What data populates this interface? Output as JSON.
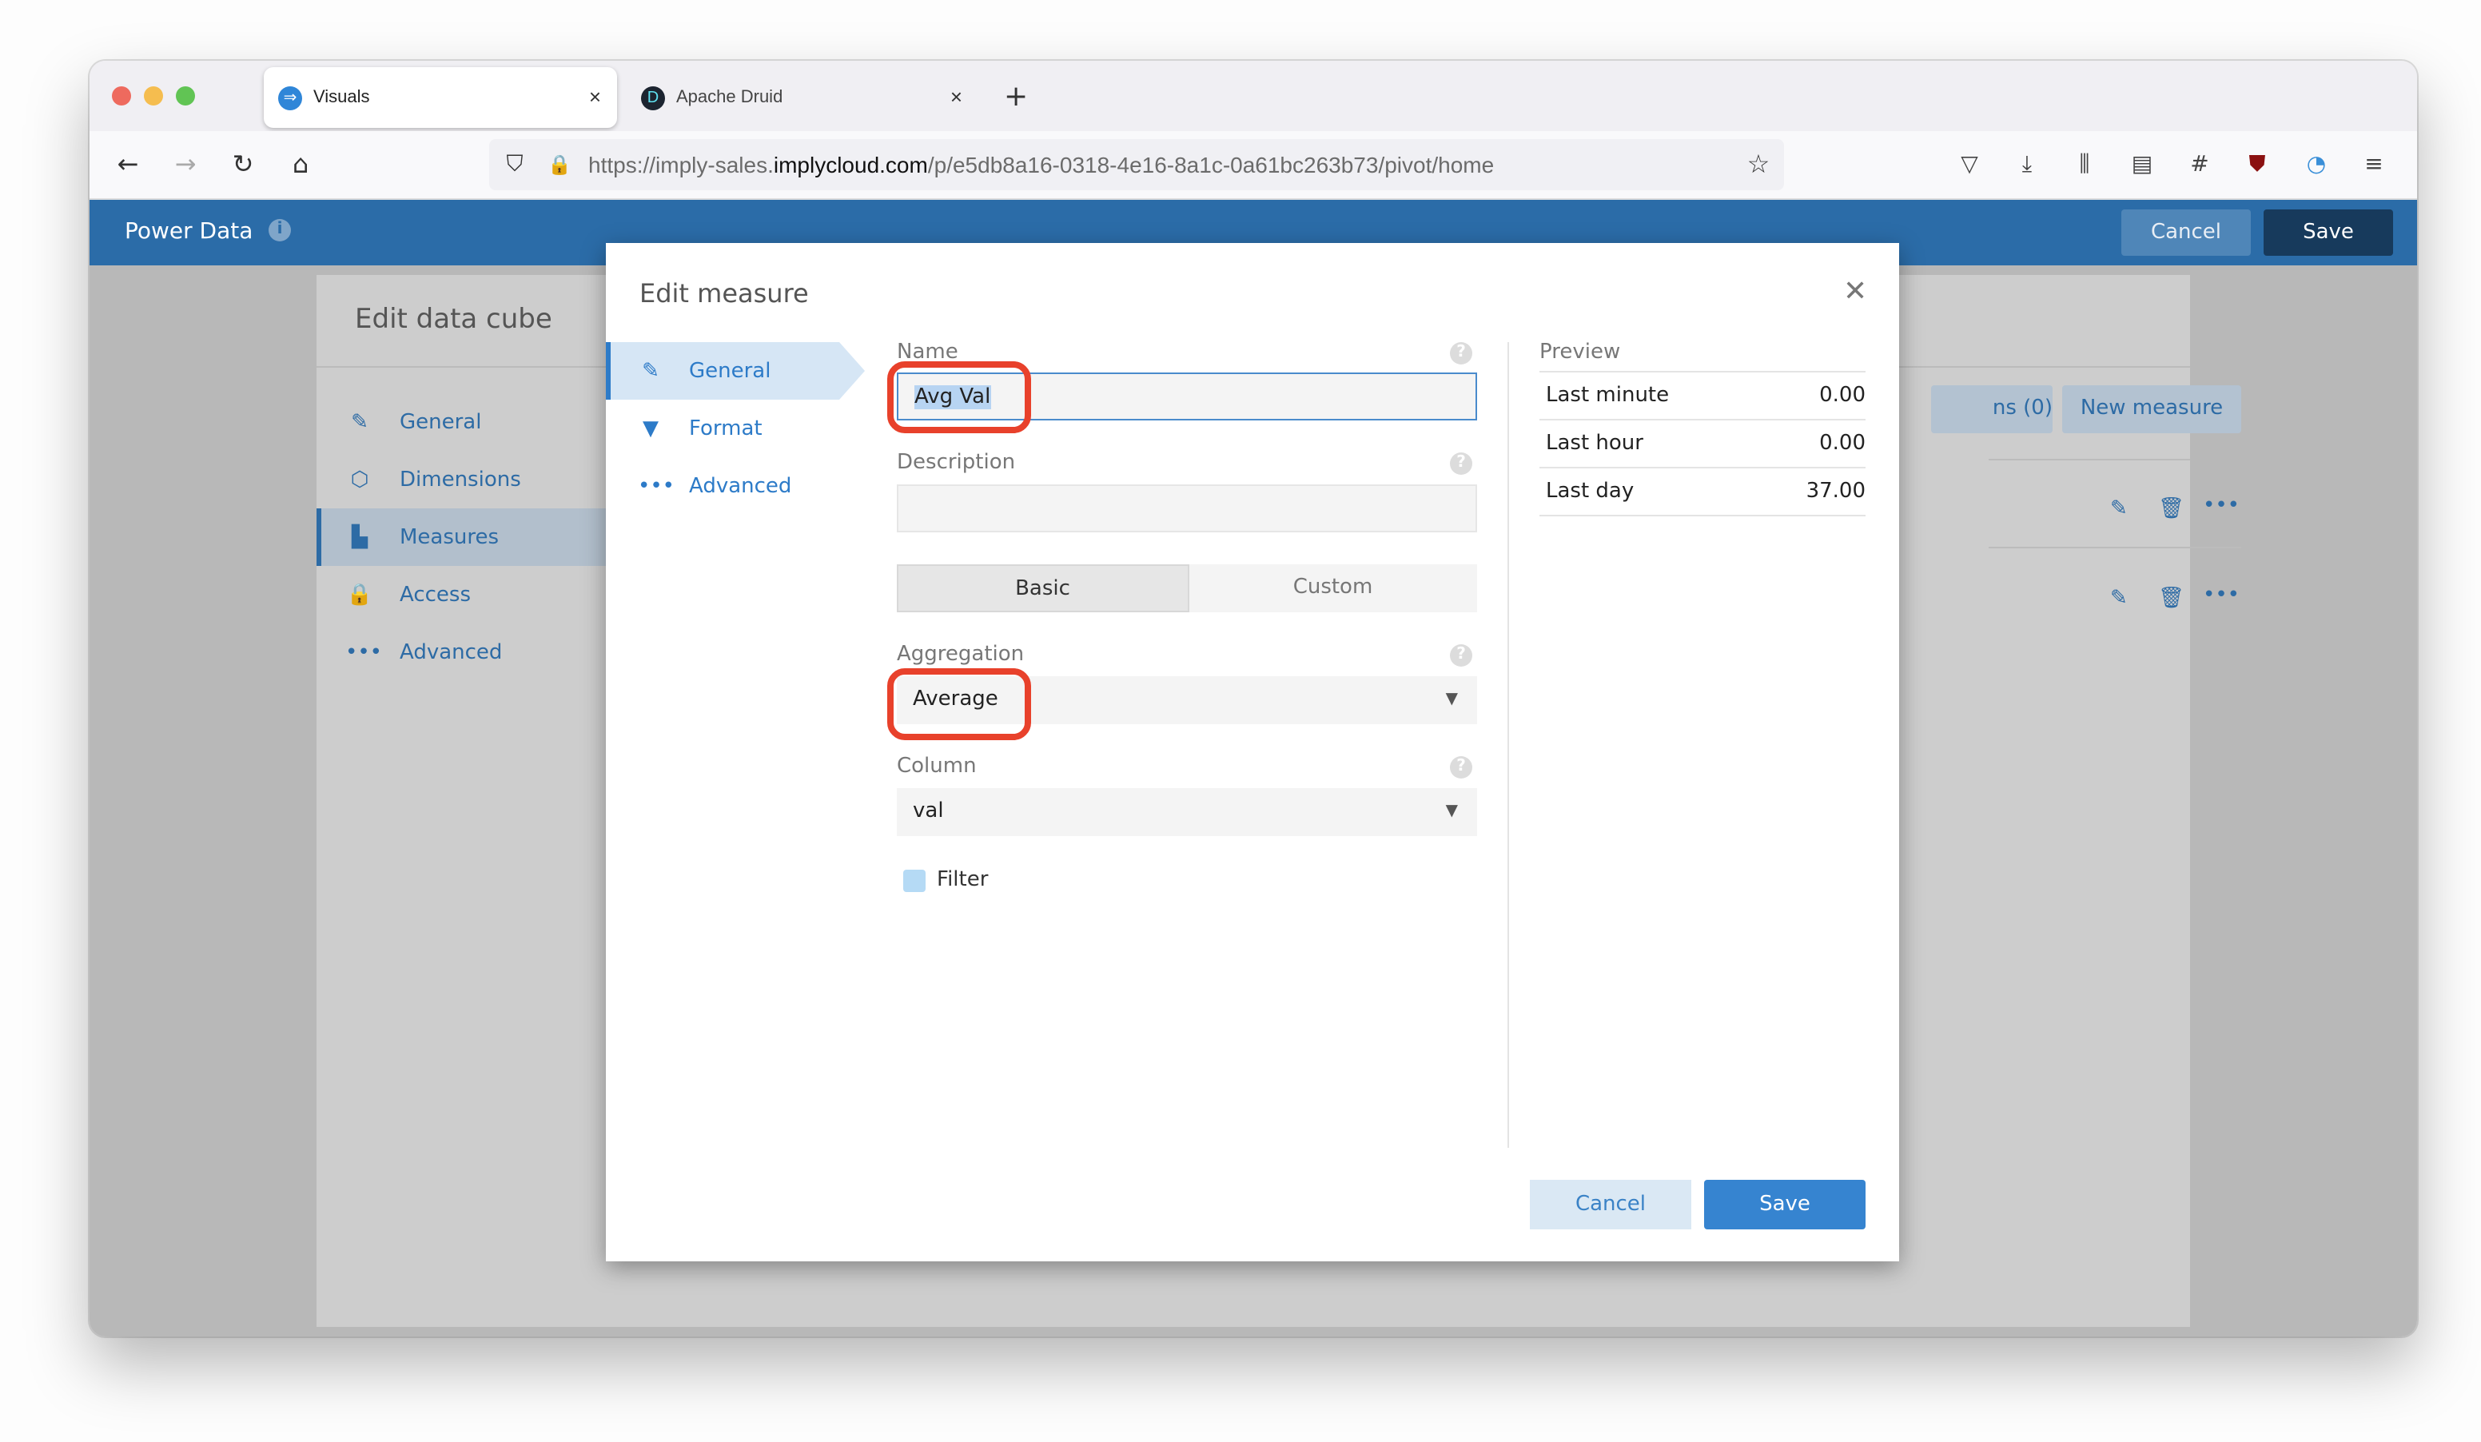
{
  "browser": {
    "tabs": [
      {
        "title": "Visuals",
        "favicon": "arrow-right-circle-icon",
        "active": true
      },
      {
        "title": "Apache Druid",
        "favicon": "druid-logo-icon",
        "active": false
      }
    ],
    "close_glyph": "×",
    "new_tab_glyph": "+",
    "url_prefix": "https://imply-sales.",
    "url_domain": "implycloud.com",
    "url_suffix": "/p/e5db8a16-0318-4e16-8a1c-0a61bc263b73/pivot/home",
    "nav_icons": {
      "back": "←",
      "forward": "→",
      "reload": "↻",
      "home": "⌂",
      "shield": "⛉",
      "lock": "🔒",
      "star": "☆"
    },
    "toolbar_icons": [
      "pocket-icon",
      "download-icon",
      "library-icon",
      "sidebar-icon",
      "extension-icon",
      "ublock-icon",
      "vpn-icon",
      "menu-icon"
    ]
  },
  "app": {
    "title": "Power Data",
    "header_cancel": "Cancel",
    "header_save": "Save",
    "accent": "#2b6ca8"
  },
  "cube": {
    "title": "Edit data cube",
    "nav": [
      {
        "label": "General",
        "icon": "edit-square-icon",
        "active": false
      },
      {
        "label": "Dimensions",
        "icon": "cube-icon",
        "active": false
      },
      {
        "label": "Measures",
        "icon": "measures-icon",
        "active": true
      },
      {
        "label": "Access",
        "icon": "lock-icon",
        "active": false
      },
      {
        "label": "Advanced",
        "icon": "more-dots-icon",
        "active": false
      }
    ],
    "suggestions_button_partial": "ns (0)",
    "new_measure_button": "New measure"
  },
  "modal": {
    "title": "Edit measure",
    "nav": [
      {
        "label": "General",
        "icon": "pencil-icon",
        "active": true
      },
      {
        "label": "Format",
        "icon": "paintbrush-icon",
        "active": false
      },
      {
        "label": "Advanced",
        "icon": "more-dots-icon",
        "active": false
      }
    ],
    "name_label": "Name",
    "name_value": "Avg Val",
    "description_label": "Description",
    "description_value": "",
    "mode_options": [
      "Basic",
      "Custom"
    ],
    "mode_selected": "Basic",
    "aggregation_label": "Aggregation",
    "aggregation_value": "Average",
    "column_label": "Column",
    "column_value": "val",
    "filter_label": "Filter",
    "filter_checked": false,
    "preview": {
      "label": "Preview",
      "rows": [
        {
          "period": "Last minute",
          "value": "0.00"
        },
        {
          "period": "Last hour",
          "value": "0.00"
        },
        {
          "period": "Last day",
          "value": "37.00"
        }
      ]
    },
    "cancel_label": "Cancel",
    "save_label": "Save",
    "annotation_color": "#e8412b"
  }
}
